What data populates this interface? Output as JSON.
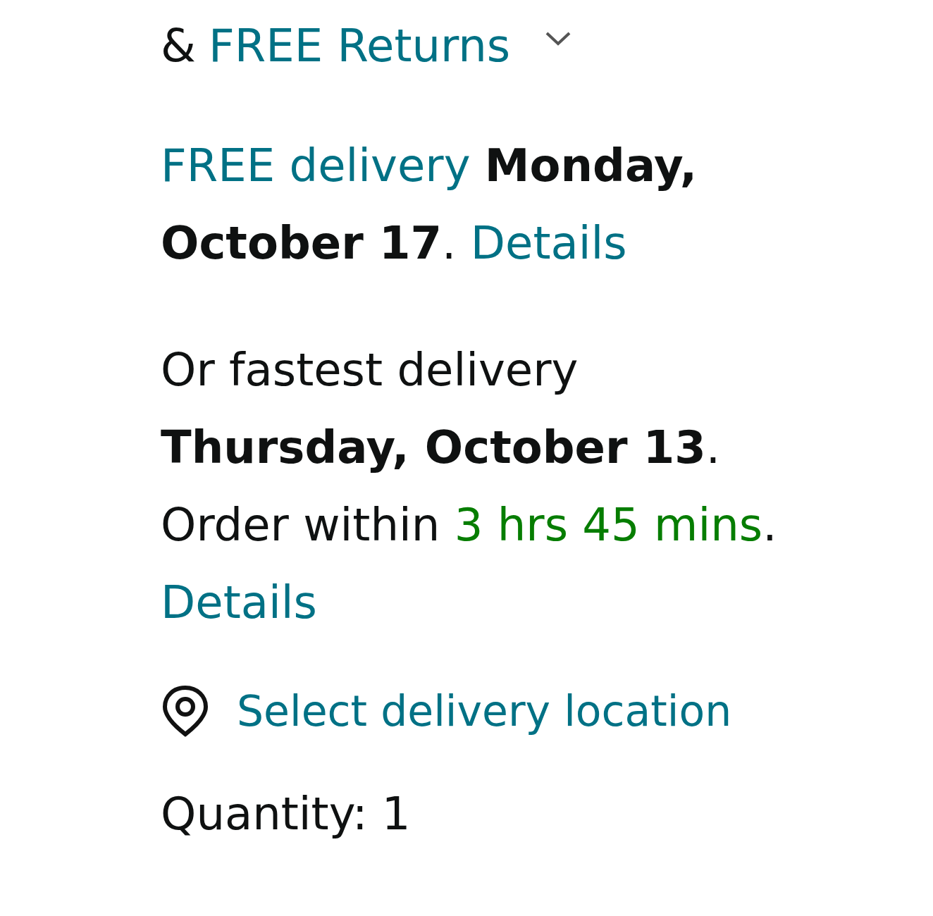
{
  "returns": {
    "prefix": "&",
    "link": "FREE Returns",
    "expanded": false
  },
  "delivery": {
    "link": "FREE delivery",
    "date": "Monday, October 17",
    "suffix": ".",
    "details": "Details"
  },
  "fastest": {
    "lead": "Or fastest delivery",
    "date": "Thursday, October 13",
    "date_suffix": ".",
    "order": "Order within",
    "countdown": "3 hrs 45 mins",
    "countdown_suffix": ".",
    "details": "Details"
  },
  "location": {
    "label": "Select delivery location"
  },
  "quantity": {
    "text": "Quantity: 1"
  }
}
